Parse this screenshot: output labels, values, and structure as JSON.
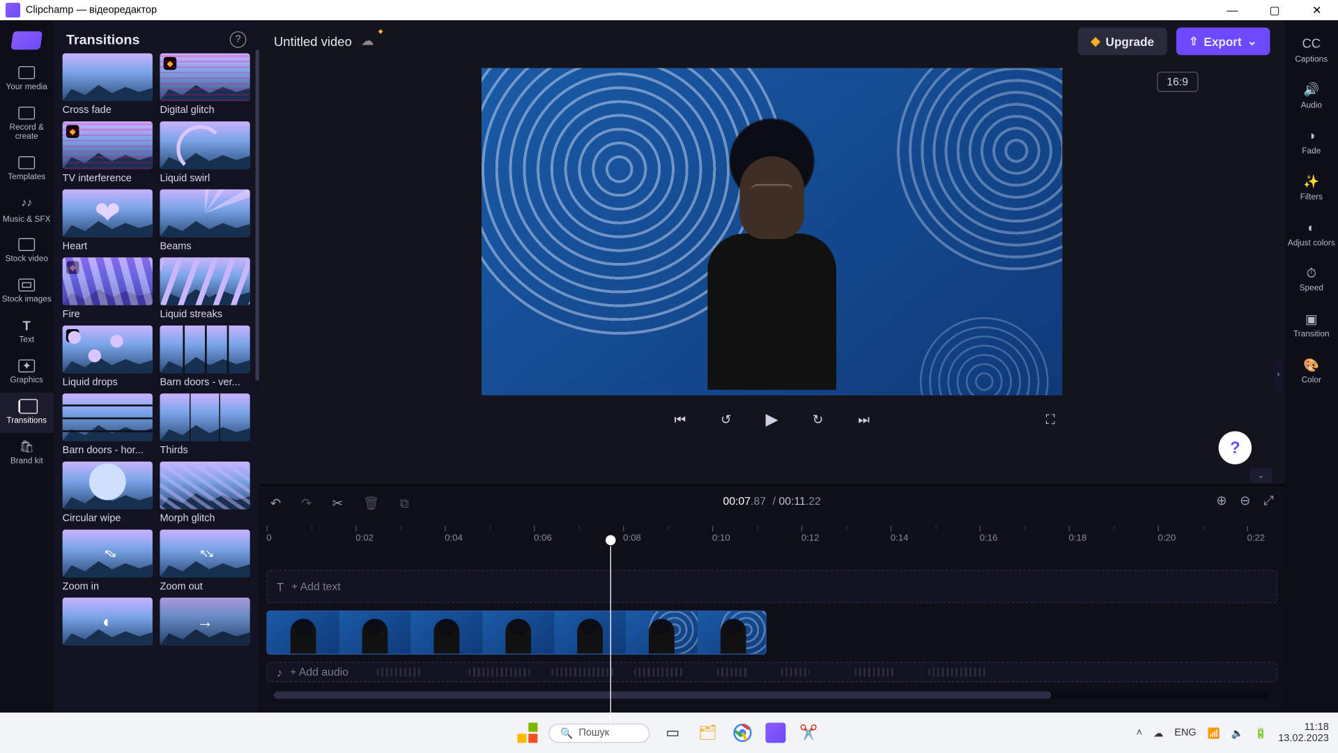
{
  "window": {
    "title": "Clipchamp — відеоредактор"
  },
  "sidebar": {
    "items": [
      {
        "label": "Your media"
      },
      {
        "label": "Record & create"
      },
      {
        "label": "Templates"
      },
      {
        "label": "Music & SFX"
      },
      {
        "label": "Stock video"
      },
      {
        "label": "Stock images"
      },
      {
        "label": "Text"
      },
      {
        "label": "Graphics"
      },
      {
        "label": "Transitions"
      },
      {
        "label": "Brand kit"
      }
    ],
    "active_index": 8
  },
  "panel": {
    "title": "Transitions",
    "items": [
      {
        "label": "Cross fade",
        "fx": "",
        "premium": false
      },
      {
        "label": "Digital glitch",
        "fx": "fx-glitch",
        "premium": true
      },
      {
        "label": "TV interference",
        "fx": "fx-glitch",
        "premium": true
      },
      {
        "label": "Liquid swirl",
        "fx": "fx-swirl",
        "premium": false
      },
      {
        "label": "Heart",
        "fx": "fx-heart",
        "premium": false
      },
      {
        "label": "Beams",
        "fx": "fx-beams",
        "premium": false
      },
      {
        "label": "Fire",
        "fx": "fx-fire",
        "premium": true
      },
      {
        "label": "Liquid streaks",
        "fx": "fx-streaks",
        "premium": false
      },
      {
        "label": "Liquid drops",
        "fx": "fx-drops",
        "premium": true
      },
      {
        "label": "Barn doors - ver...",
        "fx": "fx-barv",
        "premium": false
      },
      {
        "label": "Barn doors - hor...",
        "fx": "fx-barh",
        "premium": false
      },
      {
        "label": "Thirds",
        "fx": "fx-thirds",
        "premium": false
      },
      {
        "label": "Circular wipe",
        "fx": "fx-circle",
        "premium": false
      },
      {
        "label": "Morph glitch",
        "fx": "fx-morph",
        "premium": false
      },
      {
        "label": "Zoom in",
        "fx": "fx-zin",
        "premium": false
      },
      {
        "label": "Zoom out",
        "fx": "fx-zout",
        "premium": false
      },
      {
        "label": "",
        "fx": "fx-spinner",
        "premium": false
      },
      {
        "label": "",
        "fx": "fx-arrow",
        "premium": false
      }
    ]
  },
  "topbar": {
    "project_title": "Untitled video",
    "upgrade_label": "Upgrade",
    "export_label": "Export"
  },
  "preview": {
    "aspect_label": "16:9"
  },
  "right_rail": {
    "items": [
      {
        "label": "Captions",
        "glyph": "CC"
      },
      {
        "label": "Audio",
        "glyph": "🔊"
      },
      {
        "label": "Fade",
        "glyph": "◑"
      },
      {
        "label": "Filters",
        "glyph": "✨"
      },
      {
        "label": "Adjust colors",
        "glyph": "◐"
      },
      {
        "label": "Speed",
        "glyph": "⏱"
      },
      {
        "label": "Transition",
        "glyph": "▣"
      },
      {
        "label": "Color",
        "glyph": "🎨"
      }
    ]
  },
  "timeline": {
    "current": "00:07",
    "current_frac": ".87",
    "total": "00:11",
    "total_frac": ".22",
    "ruler_start": 0,
    "ruler_step": 2,
    "ruler_count": 12,
    "playhead_seconds": 7.87,
    "text_track_label": "+ Add text",
    "audio_track_label": "+ Add audio",
    "clip": {
      "start_seconds": 0,
      "end_seconds": 11.22,
      "frames": 7
    }
  },
  "taskbar": {
    "search_placeholder": "Пошук",
    "lang": "ENG",
    "time": "11:18",
    "date": "13.02.2023"
  },
  "colors": {
    "accent": "#6d4aff",
    "premium": "#ffb020"
  }
}
